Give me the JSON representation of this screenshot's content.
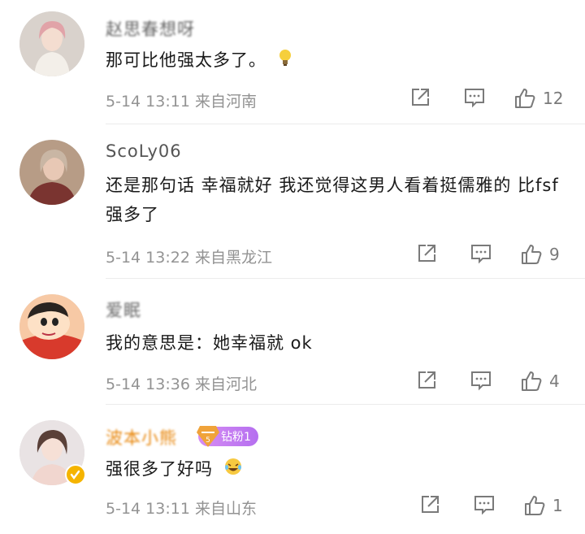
{
  "comments": [
    {
      "name": "赵思春想呀",
      "text": "那可比他强太多了。",
      "meta": "5-14 13:11 来自河南",
      "likes": "12",
      "avatar_icon": "user-avatar-woman"
    },
    {
      "name": "ScoLy06",
      "text": "还是那句话 幸福就好 我还觉得这男人看着挺儒雅的 比fsf强多了",
      "meta": "5-14 13:22 来自黑龙江",
      "likes": "9",
      "avatar_icon": "user-avatar-woman"
    },
    {
      "name": "爱眠",
      "text": "我的意思是：她幸福就 ok",
      "meta": "5-14 13:36 来自河北",
      "likes": "4",
      "avatar_icon": "cartoon-avatar"
    },
    {
      "name": "波本小熊",
      "badge": "钻粉1",
      "text": "强很多了好吗",
      "meta": "5-14 13:11 来自山东",
      "likes": "1",
      "avatar_icon": "user-avatar-woman"
    }
  ],
  "icons": {
    "share": "share-icon",
    "comment": "comment-icon",
    "like": "thumbs-up-icon",
    "lightbulb": "lightbulb-icon",
    "laugh": "laughing-emoji-icon",
    "verified": "verified-badge-icon"
  },
  "colors": {
    "name_gray": "#555555",
    "name_vip": "#e8870d",
    "meta_gray": "#939393",
    "badge_purple": "#c07ef2"
  }
}
